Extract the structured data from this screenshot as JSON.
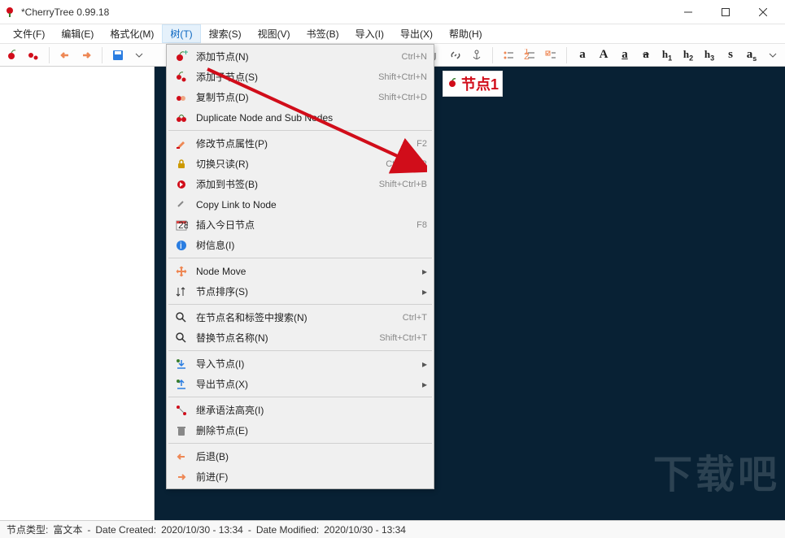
{
  "window": {
    "title": "*CherryTree 0.99.18"
  },
  "menu": {
    "items": [
      {
        "label": "文件(F)"
      },
      {
        "label": "编辑(E)"
      },
      {
        "label": "格式化(M)"
      },
      {
        "label": "树(T)",
        "active": true
      },
      {
        "label": "搜索(S)"
      },
      {
        "label": "视图(V)"
      },
      {
        "label": "书签(B)"
      },
      {
        "label": "导入(I)"
      },
      {
        "label": "导出(X)"
      },
      {
        "label": "帮助(H)"
      }
    ]
  },
  "dropdown": {
    "items": [
      {
        "icon": "cherry-add",
        "label": "添加节点(N)",
        "shortcut": "Ctrl+N",
        "highlight": true
      },
      {
        "icon": "cherry-child",
        "label": "添加子节点(S)",
        "shortcut": "Shift+Ctrl+N"
      },
      {
        "icon": "cherry-copy",
        "label": "复制节点(D)",
        "shortcut": "Shift+Ctrl+D"
      },
      {
        "icon": "cherries",
        "label": "Duplicate Node and Sub Nodes",
        "shortcut": ""
      },
      {
        "divider": true
      },
      {
        "icon": "paint",
        "label": "修改节点属性(P)",
        "shortcut": "F2"
      },
      {
        "icon": "lock",
        "label": "切换只读(R)",
        "shortcut": "Ctrl+Alt+R"
      },
      {
        "icon": "bookmark",
        "label": "添加到书签(B)",
        "shortcut": "Shift+Ctrl+B"
      },
      {
        "icon": "link",
        "label": "Copy Link to Node",
        "shortcut": ""
      },
      {
        "icon": "calendar",
        "label": "插入今日节点",
        "shortcut": "F8"
      },
      {
        "icon": "info",
        "label": "树信息(I)",
        "shortcut": ""
      },
      {
        "divider": true
      },
      {
        "icon": "move",
        "label": "Node Move",
        "shortcut": "",
        "submenu": true
      },
      {
        "icon": "sort",
        "label": "节点排序(S)",
        "shortcut": "",
        "submenu": true
      },
      {
        "divider": true
      },
      {
        "icon": "search",
        "label": "在节点名和标签中搜索(N)",
        "shortcut": "Ctrl+T"
      },
      {
        "icon": "search",
        "label": "替换节点名称(N)",
        "shortcut": "Shift+Ctrl+T"
      },
      {
        "divider": true
      },
      {
        "icon": "import",
        "label": "导入节点(I)",
        "shortcut": "",
        "submenu": true
      },
      {
        "icon": "export",
        "label": "导出节点(X)",
        "shortcut": "",
        "submenu": true
      },
      {
        "divider": true
      },
      {
        "icon": "inherit",
        "label": "继承语法高亮(I)",
        "shortcut": ""
      },
      {
        "icon": "trash",
        "label": "删除节点(E)",
        "shortcut": ""
      },
      {
        "divider": true
      },
      {
        "icon": "back",
        "label": "后退(B)",
        "shortcut": ""
      },
      {
        "icon": "forward",
        "label": "前进(F)",
        "shortcut": ""
      }
    ]
  },
  "toolbar": {
    "left": [
      {
        "name": "cherry-add-icon"
      },
      {
        "name": "cherry-child-icon"
      },
      {
        "sep": true
      },
      {
        "name": "back-icon"
      },
      {
        "name": "forward-icon"
      },
      {
        "sep": true
      },
      {
        "name": "save-icon"
      },
      {
        "name": "save-dropdown-icon"
      }
    ],
    "right": [
      {
        "name": "image-icon"
      },
      {
        "name": "table-icon"
      },
      {
        "name": "code-icon"
      },
      {
        "name": "attachment-icon"
      },
      {
        "name": "link-icon"
      },
      {
        "name": "anchor-icon"
      },
      {
        "sep": true
      },
      {
        "name": "bullet-icon"
      },
      {
        "name": "numbered-icon"
      },
      {
        "name": "todo-icon"
      },
      {
        "sep": true
      },
      {
        "text": "a",
        "class": "tb-text",
        "name": "format-a1"
      },
      {
        "text": "A",
        "class": "tb-text",
        "name": "format-a2"
      },
      {
        "text": "a",
        "class": "tb-text tb-u",
        "name": "format-underline"
      },
      {
        "text": "a",
        "class": "tb-text tb-s",
        "name": "format-strike"
      },
      {
        "html": "h<span class='tb-sub'>1</span>",
        "class": "tb-text tb-h",
        "name": "format-h1"
      },
      {
        "html": "h<span class='tb-sub'>2</span>",
        "class": "tb-text tb-h",
        "name": "format-h2"
      },
      {
        "html": "h<span class='tb-sub'>3</span>",
        "class": "tb-text tb-h",
        "name": "format-h3"
      },
      {
        "text": "s",
        "class": "tb-text",
        "name": "format-small"
      },
      {
        "html": "a<span class='tb-sub'>s</span>",
        "class": "tb-text",
        "name": "format-sup"
      },
      {
        "name": "format-dropdown-icon"
      }
    ]
  },
  "node": {
    "title": "节点1"
  },
  "status": {
    "type_label": "节点类型:",
    "type_value": "富文本",
    "created_label": "Date Created:",
    "created_value": "2020/10/30 - 13:34",
    "modified_label": "Date Modified:",
    "modified_value": "2020/10/30 - 13:34"
  },
  "watermark": "下载吧"
}
